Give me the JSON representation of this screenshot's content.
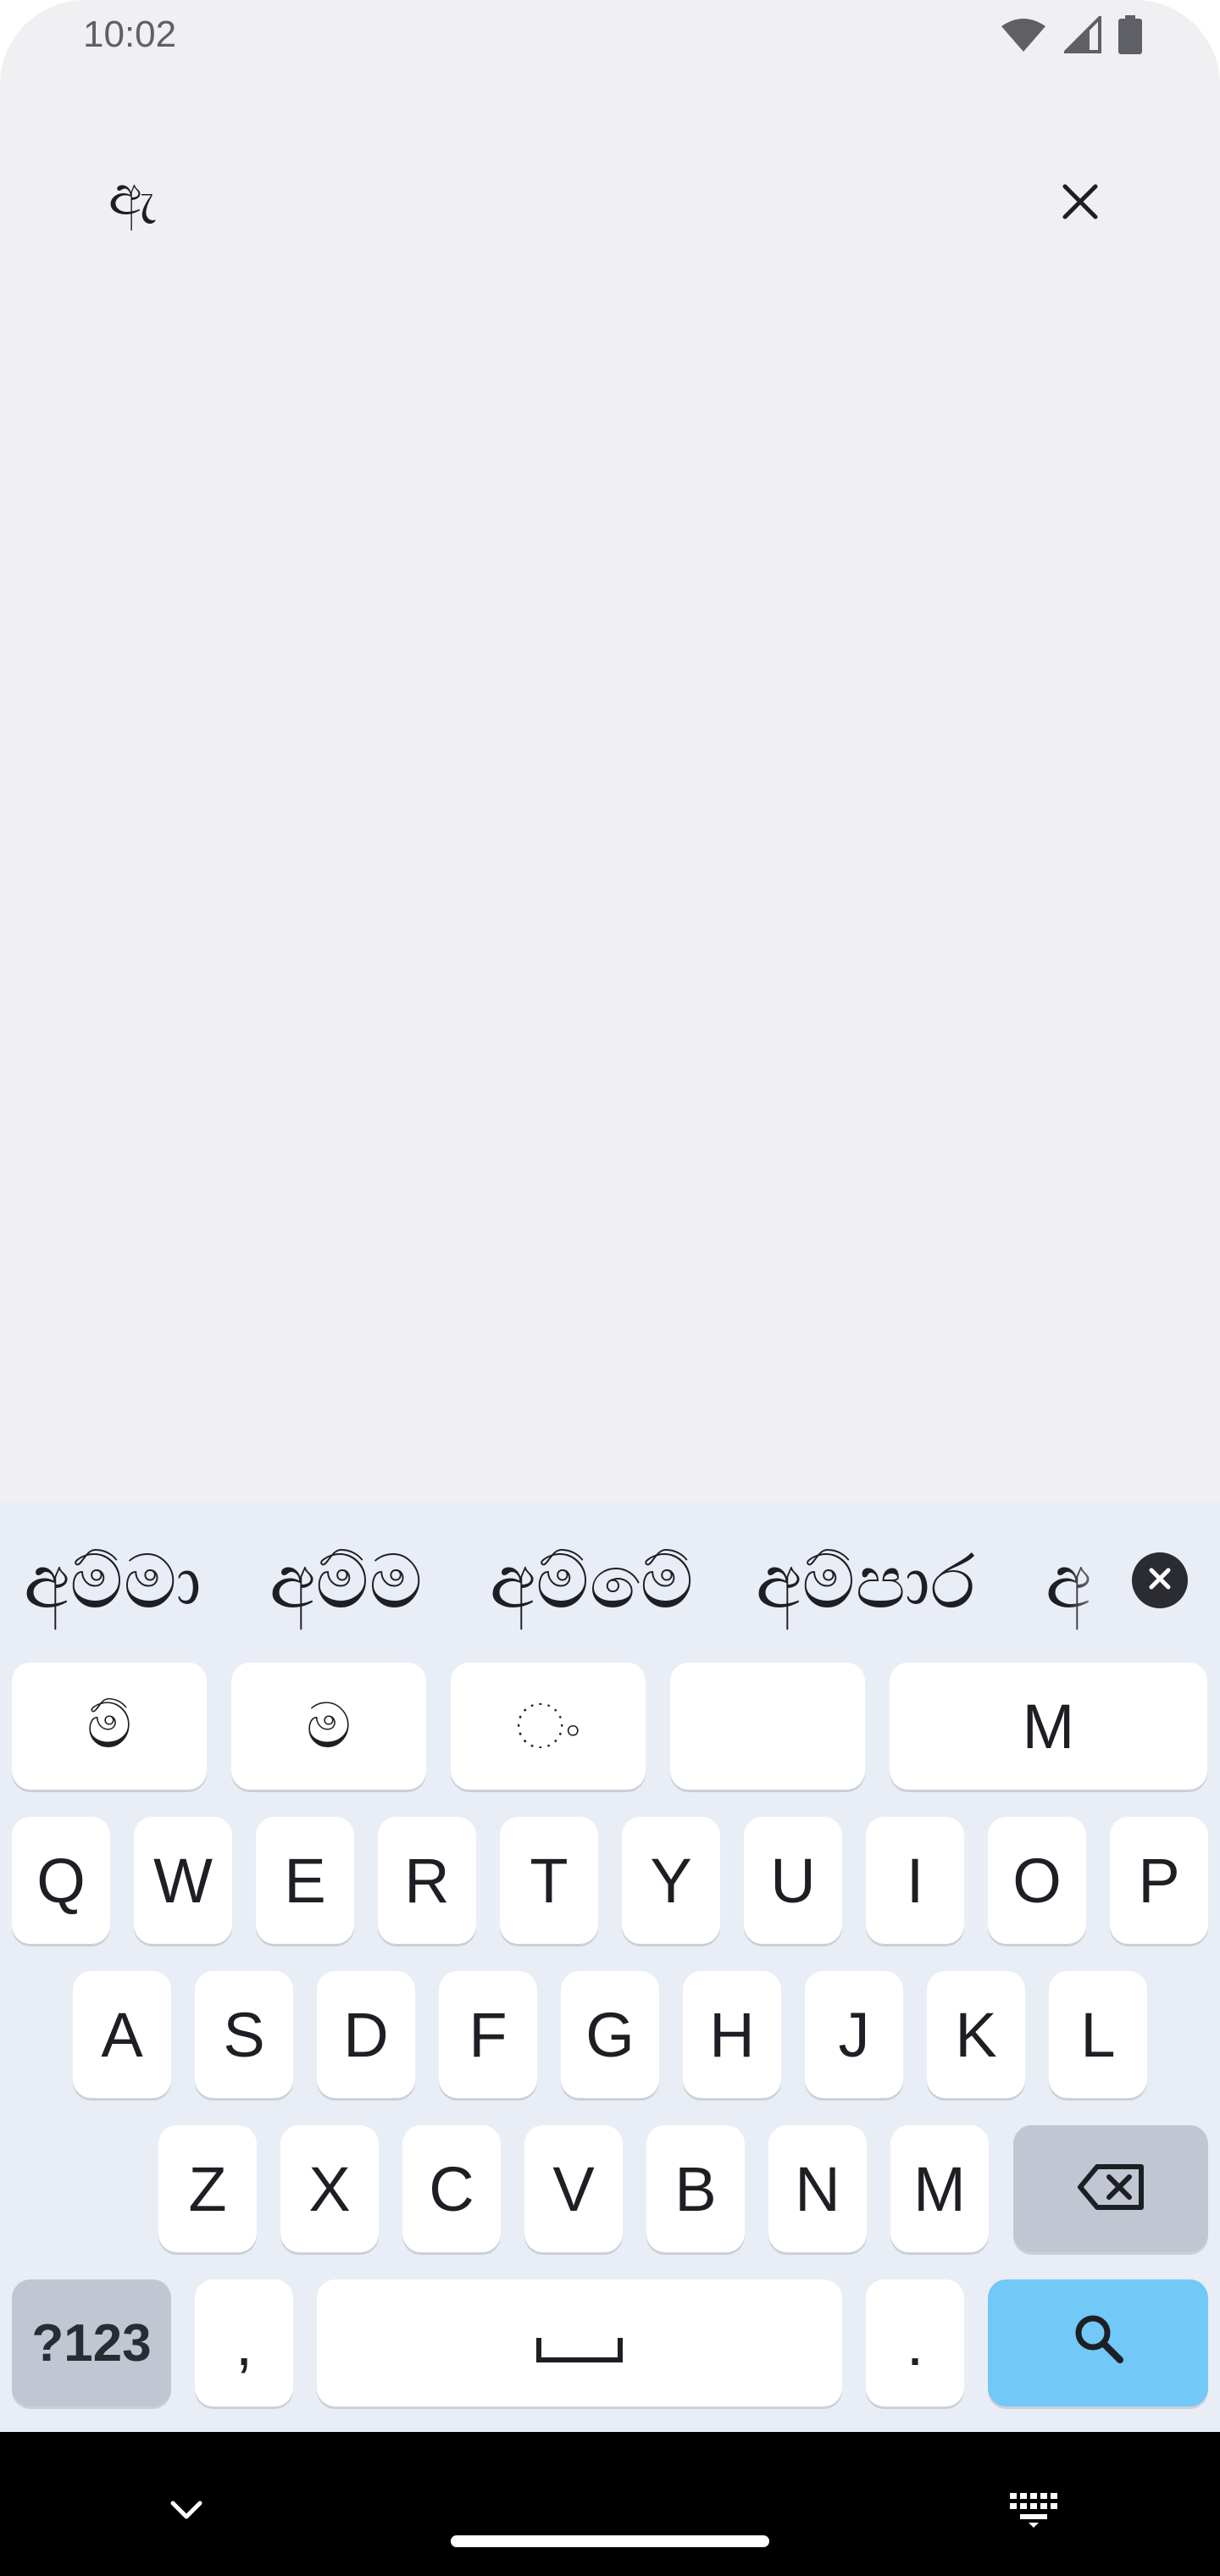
{
  "status_bar": {
    "time": "10:02",
    "icons": [
      "wifi-icon",
      "cell-signal-icon",
      "battery-icon"
    ]
  },
  "search": {
    "query": "ඇ",
    "clear_icon": "close-icon"
  },
  "keyboard": {
    "suggestions": [
      "අම්මා",
      "අම්ම",
      "අම්මේ",
      "අම්පාර",
      "අ"
    ],
    "special_row": [
      "ම්",
      "ම",
      "◌ං",
      "",
      "M"
    ],
    "row1": [
      "Q",
      "W",
      "E",
      "R",
      "T",
      "Y",
      "U",
      "I",
      "O",
      "P"
    ],
    "row2": [
      "A",
      "S",
      "D",
      "F",
      "G",
      "H",
      "J",
      "K",
      "L"
    ],
    "row3": [
      "Z",
      "X",
      "C",
      "V",
      "B",
      "N",
      "M"
    ],
    "bottom": {
      "symbols_label": "?123",
      "comma_label": ",",
      "period_label": "."
    },
    "colors": {
      "background": "#e8edf6",
      "key": "#ffffff",
      "function_key": "#c1c7d2",
      "action_key": "#72c8f6"
    }
  },
  "nav_bar": {
    "icons": [
      "chevron-down-icon",
      "keyboard-icon"
    ]
  }
}
